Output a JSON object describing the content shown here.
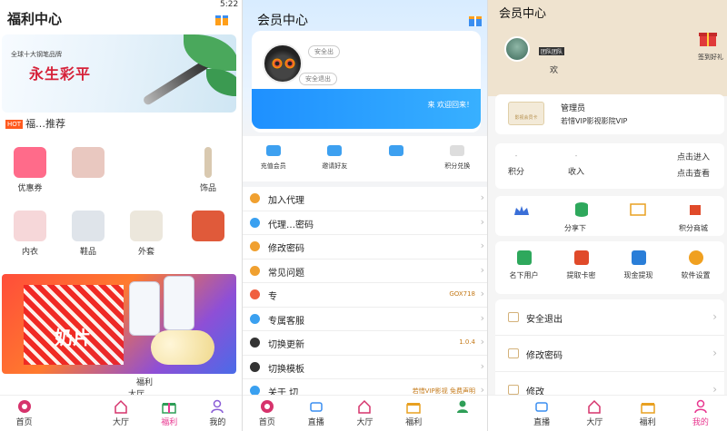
{
  "panel1": {
    "title": "福利中心",
    "status_time": "5:22",
    "banner": {
      "tagline": "全球十大钢笔品牌",
      "headline": "永生彩平",
      "small": ""
    },
    "hot_badge": "HOT",
    "hot_label": "福…推荐",
    "categories": [
      {
        "label": "优惠券",
        "color": "#ff6b8a"
      },
      {
        "label": "",
        "color": "#e9c8c0"
      },
      {
        "label": "",
        "color": "#ffffff"
      },
      {
        "label": "饰品",
        "color": "#d9c9b0"
      },
      {
        "label": "内衣",
        "color": "#f6d7d9"
      },
      {
        "label": "鞋品",
        "color": "#dfe4ea"
      },
      {
        "label": "外套",
        "color": "#ece7dc"
      },
      {
        "label": "",
        "color": "#e05a3a"
      }
    ],
    "promo_text": "奶片",
    "float_labels": [
      "福利",
      "大厅"
    ],
    "tabs": [
      {
        "label": "首页",
        "icon": "home-icon",
        "active": false
      },
      {
        "label": "",
        "icon": "live-icon",
        "active": false
      },
      {
        "label": "大厅",
        "icon": "hall-icon",
        "active": false
      },
      {
        "label": "福利",
        "icon": "gift-icon",
        "active": true
      },
      {
        "label": "我的",
        "icon": "user-icon",
        "active": false
      }
    ]
  },
  "panel2": {
    "title": "会员中心",
    "pill_top": "安全出",
    "pill_logout": "安全退出",
    "banner_text": "来 欢迎回来！",
    "quick": [
      {
        "label": "充值会员"
      },
      {
        "label": "邀请好友"
      },
      {
        "label": ""
      },
      {
        "label": "积分兑换"
      }
    ],
    "rows": [
      {
        "label": "加入代理",
        "icon_color": "#f0a030",
        "right": ""
      },
      {
        "label": "代理…密码",
        "icon_color": "#3aa0f0",
        "right": ""
      },
      {
        "label": "修改密码",
        "icon_color": "#f0a030",
        "right": ""
      },
      {
        "label": "常见问题",
        "icon_color": "#f0a030",
        "right": ""
      },
      {
        "label": "专",
        "icon_color": "#f06040",
        "right": "GOX718"
      },
      {
        "label": "专属客服",
        "icon_color": "#3aa0f0",
        "right": ""
      },
      {
        "label": "切换更新",
        "icon_color": "#333333",
        "right": "1.0.4"
      },
      {
        "label": "切换模板",
        "icon_color": "#333333",
        "right": ""
      },
      {
        "label": "关于 切",
        "icon_color": "#3aa0f0",
        "right": "若惜VIP影视 免费声明"
      }
    ],
    "tabs": [
      {
        "label": "首页",
        "icon": "home-icon",
        "active": false
      },
      {
        "label": "直播",
        "icon": "live-icon",
        "active": false
      },
      {
        "label": "大厅",
        "icon": "hall-icon",
        "active": false
      },
      {
        "label": "福利",
        "icon": "gift-icon",
        "active": false
      },
      {
        "label": "",
        "icon": "user-icon",
        "active": false
      }
    ]
  },
  "panel3": {
    "title": "会员中心",
    "sign_label": "签到好礼",
    "avatar_badge": "团队团队",
    "welcome": "欢",
    "vip_card": "影视会员卡",
    "vip_name": "管理员",
    "vip_level": "若惜VIP影视影院VIP",
    "stats": [
      {
        "label": "积分",
        "value": "-"
      },
      {
        "label": "收入",
        "value": "-"
      },
      {
        "label": "点击进入",
        "value": ""
      },
      {
        "label": "点击查看",
        "value": ""
      }
    ],
    "actions": [
      {
        "label": "",
        "color": "#3a6fd8"
      },
      {
        "label": "分享下",
        "color": "#2ea85c"
      },
      {
        "label": "",
        "color": "#e8a020"
      },
      {
        "label": "积分商城",
        "color": "#e04a2a"
      }
    ],
    "grid": [
      {
        "label": "名下用户",
        "color": "#2ea85c"
      },
      {
        "label": "提取卡密",
        "color": "#e04a2a"
      },
      {
        "label": "现金提现",
        "color": "#2a7ed8"
      },
      {
        "label": "软件设置",
        "color": "#f0a020"
      }
    ],
    "rows": [
      {
        "label": "安全退出"
      },
      {
        "label": "修改密码"
      },
      {
        "label": "修改"
      }
    ],
    "tabs": [
      {
        "label": "直播",
        "icon": "live-icon",
        "active": false
      },
      {
        "label": "大厅",
        "icon": "hall-icon",
        "active": false
      },
      {
        "label": "福利",
        "icon": "gift-icon",
        "active": false
      },
      {
        "label": "我的",
        "icon": "user-icon",
        "active": true
      }
    ]
  }
}
